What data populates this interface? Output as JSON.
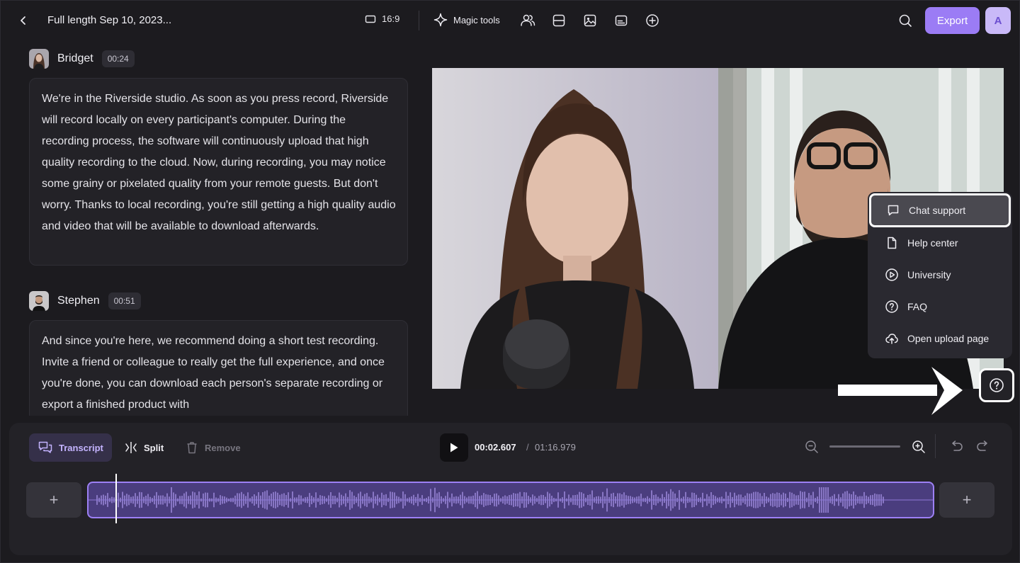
{
  "header": {
    "title": "Full length Sep 10, 2023...",
    "aspect_ratio": "16:9",
    "magic_tools_label": "Magic tools",
    "export_label": "Export",
    "avatar_initial": "A"
  },
  "transcript": [
    {
      "speaker": "Bridget",
      "time": "00:24",
      "text": "We're in the Riverside studio. As soon as you press record, Riverside will record locally on every participant's computer. During the recording process, the software will continuously upload that high quality recording to the cloud. Now, during recording, you may notice some grainy or pixelated quality from your remote guests. But don't worry. Thanks to local recording, you're still getting a high quality audio and video that will be available to download afterwards."
    },
    {
      "speaker": "Stephen",
      "time": "00:51",
      "text": "And since you're here, we recommend doing a short test recording. Invite a friend or colleague to really get the full experience, and once you're done, you can download each person's separate recording or export a finished product with"
    }
  ],
  "help_menu": {
    "items": [
      {
        "label": "Chat support",
        "icon": "chat-bubble-icon",
        "active": true
      },
      {
        "label": "Help center",
        "icon": "document-icon"
      },
      {
        "label": "University",
        "icon": "play-circle-icon"
      },
      {
        "label": "FAQ",
        "icon": "question-circle-icon"
      },
      {
        "label": "Open upload page",
        "icon": "cloud-upload-icon"
      }
    ]
  },
  "timeline": {
    "tools": {
      "transcript_label": "Transcript",
      "split_label": "Split",
      "remove_label": "Remove"
    },
    "current_time": "00:02.607",
    "separator": "/",
    "total_time": "01:16.979",
    "zoom_level": 0.5
  },
  "colors": {
    "accent": "#9b7cf5",
    "background": "#1c1b1f",
    "panel": "#232227",
    "clip": "#4a3d7e"
  }
}
